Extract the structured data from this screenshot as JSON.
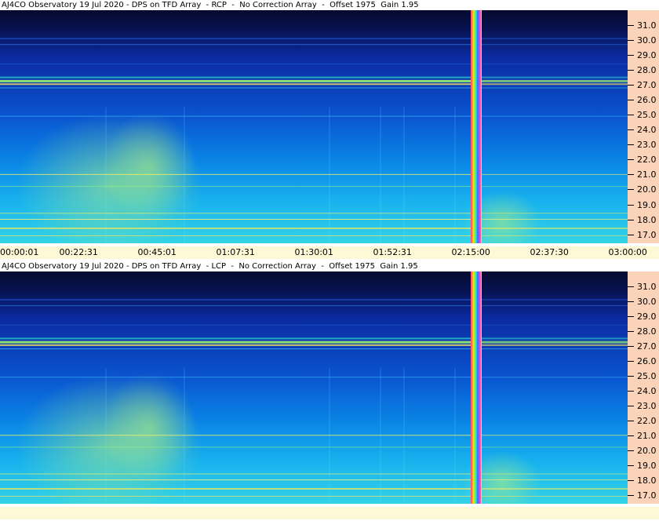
{
  "panels": [
    {
      "title": "AJ4CO Observatory 19 Jul 2020 - DPS on TFD Array  - RCP  -  No Correction Array  -  Offset 1975  Gain 1.95"
    },
    {
      "title": "AJ4CO Observatory 19 Jul 2020 - DPS on TFD Array  - LCP  -  No Correction Array  -  Offset 1975  Gain 1.95"
    }
  ],
  "chart_data": [
    {
      "type": "heatmap",
      "title": "AJ4CO Observatory 19 Jul 2020 - DPS on TFD Array  - RCP  -  No Correction Array  -  Offset 1975  Gain 1.95",
      "ylabel": "",
      "xlabel": "",
      "y_ticks": [
        "31.0",
        "30.0",
        "29.0",
        "28.0",
        "27.0",
        "26.0",
        "25.0",
        "24.0",
        "23.0",
        "22.0",
        "21.0",
        "20.0",
        "19.0",
        "18.0",
        "17.0"
      ],
      "y_range": [
        16.4,
        32.0
      ],
      "x_ticks": [
        "00:00:01",
        "00:22:31",
        "00:45:01",
        "01:07:31",
        "01:30:01",
        "01:52:31",
        "02:15:00",
        "02:37:30",
        "03:00:00"
      ],
      "features": [
        "strong band near 27.0",
        "gap marker near 02:15:00"
      ]
    },
    {
      "type": "heatmap",
      "title": "AJ4CO Observatory 19 Jul 2020 - DPS on TFD Array  - LCP  -  No Correction Array  -  Offset 1975  Gain 1.95",
      "ylabel": "",
      "xlabel": "",
      "y_ticks": [
        "31.0",
        "30.0",
        "29.0",
        "28.0",
        "27.0",
        "26.0",
        "25.0",
        "24.0",
        "23.0",
        "22.0",
        "21.0",
        "20.0",
        "19.0",
        "18.0",
        "17.0"
      ],
      "y_range": [
        16.4,
        32.0
      ],
      "x_ticks": [],
      "features": [
        "strong band near 27.0",
        "gap marker near 02:15:00"
      ]
    }
  ]
}
